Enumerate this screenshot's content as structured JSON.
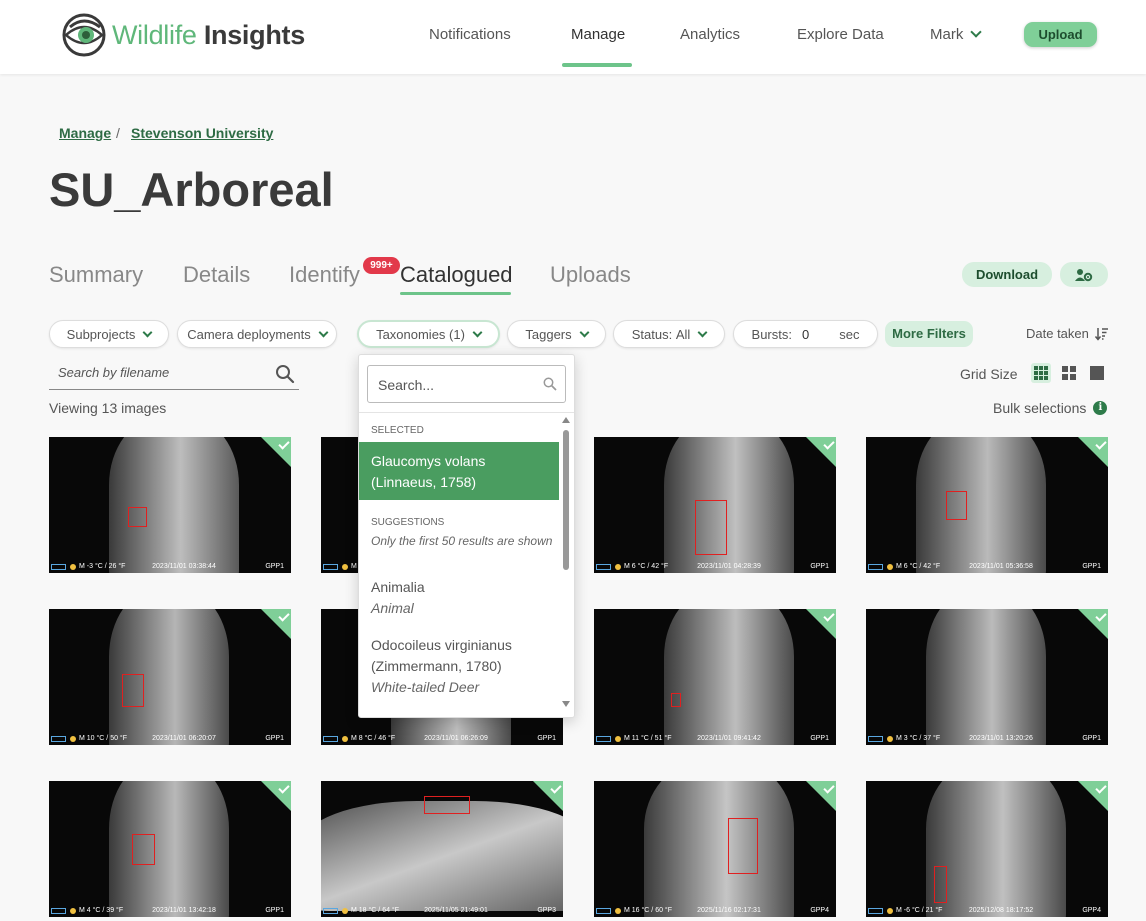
{
  "brand": {
    "word1": "Wildlife",
    "word2": " Insights"
  },
  "nav": {
    "items": [
      "Notifications",
      "Manage",
      "Analytics",
      "Explore Data"
    ],
    "user": "Mark",
    "upload_label": "Upload",
    "accent_color": "#6dc48a"
  },
  "breadcrumb": [
    "Manage",
    "Stevenson University"
  ],
  "breadcrumb_separator": "/",
  "project_title": "SU_Arboreal",
  "tabs": [
    "Summary",
    "Details",
    "Identify",
    "Catalogued",
    "Uploads"
  ],
  "identify_badge": "999+",
  "actions": {
    "download_label": "Download",
    "people_icon": "people-settings-icon"
  },
  "filters": {
    "subprojects": "Subprojects",
    "camera_deployments": "Camera deployments",
    "taxonomies": "Taxonomies (1)",
    "taggers": "Taggers",
    "status_label": "Status:",
    "status_value": "All",
    "bursts_label": "Bursts:",
    "bursts_value": "0",
    "bursts_unit": "sec",
    "more_filters": "More Filters",
    "sort_label": "Date taken"
  },
  "search": {
    "placeholder": "Search by filename"
  },
  "viewing_text": "Viewing 13 images",
  "grid_size_label": "Grid Size",
  "bulk_label": "Bulk selections",
  "dropdown": {
    "search_placeholder": "Search...",
    "selected_header": "SELECTED",
    "selected_item": "Glaucomys volans (Linnaeus, 1758)",
    "suggestions_header": "SUGGESTIONS",
    "suggestions_note": "Only the first 50 results are shown",
    "items": [
      {
        "scientific": "Animalia",
        "common": "Animal"
      },
      {
        "scientific": "Odocoileus virginianus (Zimmermann, 1780)",
        "common": "White-tailed Deer"
      }
    ]
  },
  "images": [
    {
      "temp": "M -3 °C / 26 °F",
      "timestamp": "2023/11/01 03:38:44",
      "camera": "GPP1"
    },
    {
      "temp": "M",
      "timestamp": "",
      "camera": ""
    },
    {
      "temp": "M 6 °C / 42 °F",
      "timestamp": "2023/11/01 04:28:39",
      "camera": "GPP1"
    },
    {
      "temp": "M 6 °C / 42 °F",
      "timestamp": "2023/11/01 05:36:58",
      "camera": "GPP1"
    },
    {
      "temp": "M 10 °C / 50 °F",
      "timestamp": "2023/11/01 06:20:07",
      "camera": "GPP1"
    },
    {
      "temp": "M 8 °C / 46 °F",
      "timestamp": "2023/11/01 06:26:09",
      "camera": "GPP1"
    },
    {
      "temp": "M 11 °C / 51 °F",
      "timestamp": "2023/11/01 09:41:42",
      "camera": "GPP1"
    },
    {
      "temp": "M 3 °C / 37 °F",
      "timestamp": "2023/11/01 13:20:26",
      "camera": "GPP1"
    },
    {
      "temp": "M 4 °C / 39 °F",
      "timestamp": "2023/11/01 13:42:18",
      "camera": "GPP1"
    },
    {
      "temp": "M 18 °C / 64 °F",
      "timestamp": "2025/11/05 21:49:01",
      "camera": "GPP3"
    },
    {
      "temp": "M 16 °C / 60 °F",
      "timestamp": "2025/11/16 02:17:31",
      "camera": "GPP4"
    },
    {
      "temp": "M -6 °C / 21 °F",
      "timestamp": "2025/12/08 18:17:52",
      "camera": "GPP4"
    }
  ]
}
